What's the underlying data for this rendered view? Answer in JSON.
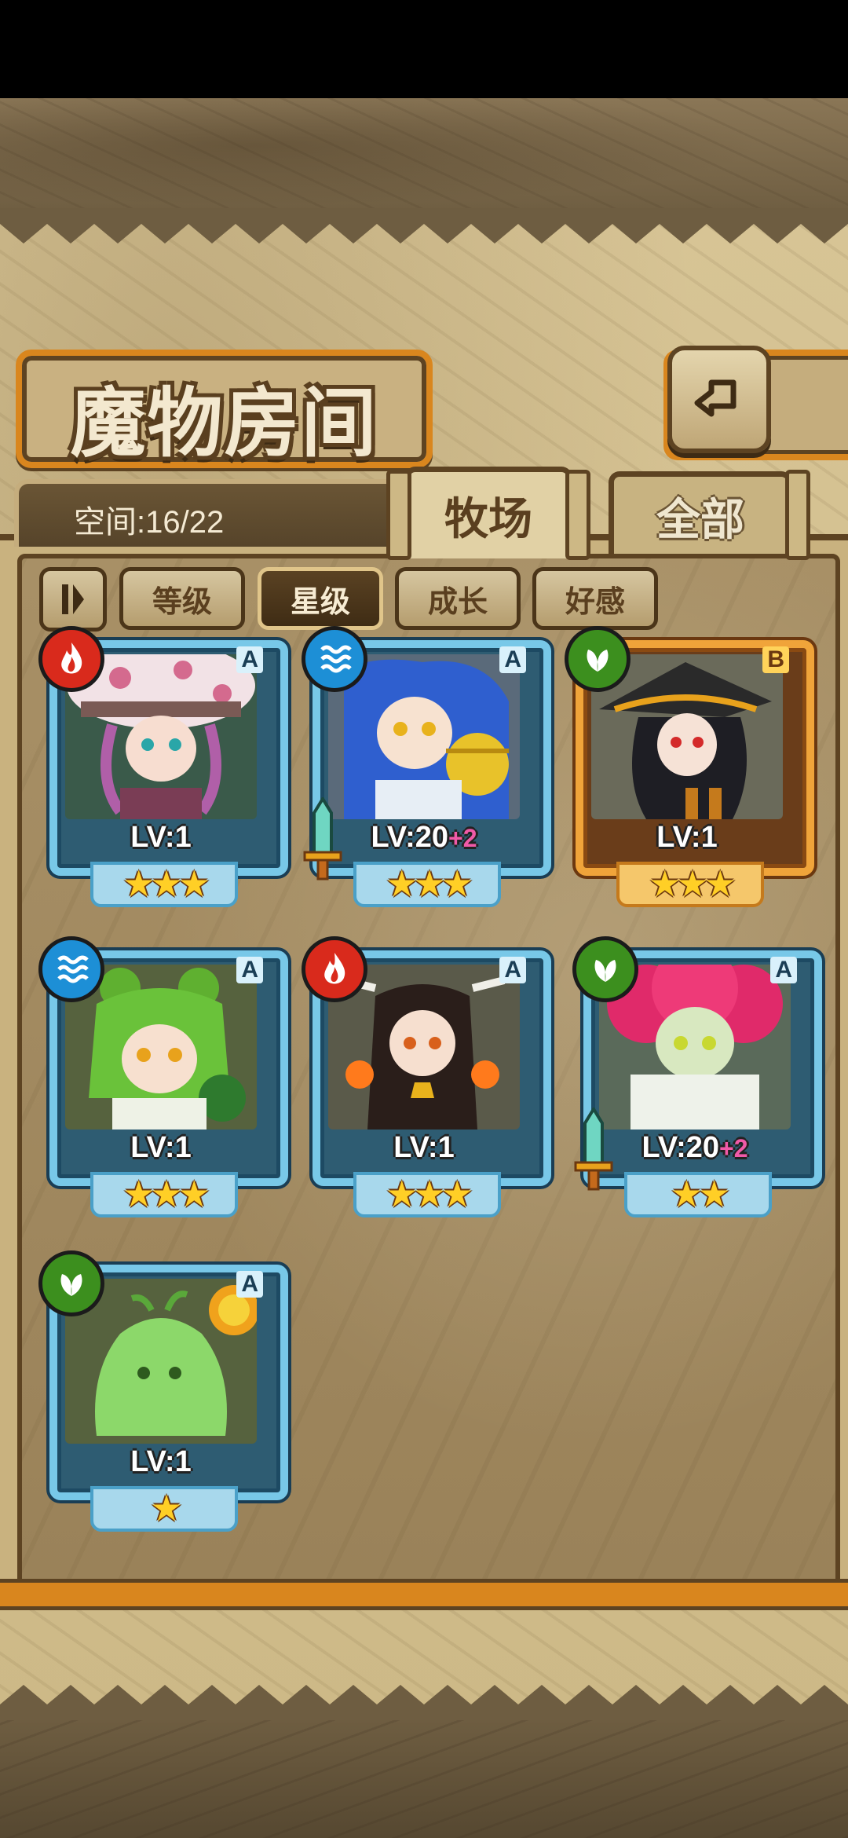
{
  "header": {
    "title": "魔物房间"
  },
  "capacity": {
    "label": "空间:16/22"
  },
  "tabs": [
    {
      "label": "牧场",
      "active": true
    },
    {
      "label": "全部",
      "active": false
    }
  ],
  "sort": {
    "buttons": [
      {
        "label": "等级",
        "active": false
      },
      {
        "label": "星级",
        "active": true
      },
      {
        "label": "成长",
        "active": false
      },
      {
        "label": "好感",
        "active": false
      }
    ]
  },
  "monsters": [
    {
      "rank": "A",
      "level": "LV:1",
      "bonus": "",
      "stars": 3,
      "element": "fire",
      "frame": "blue",
      "equipped": false,
      "stars_text": "★★★"
    },
    {
      "rank": "A",
      "level": "LV:20",
      "bonus": "+2",
      "stars": 3,
      "element": "water",
      "frame": "blue",
      "equipped": true,
      "stars_text": "★★★"
    },
    {
      "rank": "B",
      "level": "LV:1",
      "bonus": "",
      "stars": 3,
      "element": "wood",
      "frame": "gold",
      "equipped": false,
      "stars_text": "★★★"
    },
    {
      "rank": "A",
      "level": "LV:1",
      "bonus": "",
      "stars": 3,
      "element": "water",
      "frame": "blue",
      "equipped": false,
      "stars_text": "★★★"
    },
    {
      "rank": "A",
      "level": "LV:1",
      "bonus": "",
      "stars": 3,
      "element": "fire",
      "frame": "blue",
      "equipped": false,
      "stars_text": "★★★"
    },
    {
      "rank": "A",
      "level": "LV:20",
      "bonus": "+2",
      "stars": 2,
      "element": "wood",
      "frame": "blue",
      "equipped": true,
      "stars_text": "★★"
    },
    {
      "rank": "A",
      "level": "LV:1",
      "bonus": "",
      "stars": 1,
      "element": "wood",
      "frame": "blue",
      "equipped": false,
      "stars_text": "★"
    }
  ],
  "colors": {
    "accent_orange": "#d9861e",
    "frame_blue": "#78c8e8",
    "frame_gold": "#f0a43a",
    "fire": "#d92a1c",
    "water": "#1d8fd6",
    "wood": "#3c8f1e"
  }
}
